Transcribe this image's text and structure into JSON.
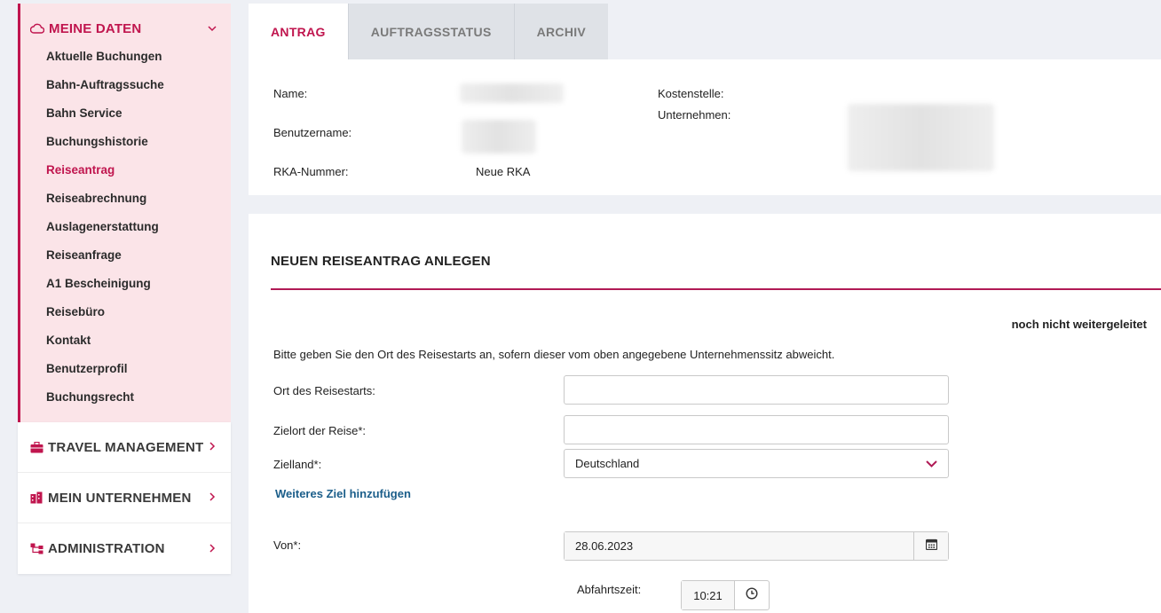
{
  "sidebar": {
    "open_group": {
      "title": "MEINE DATEN",
      "icon": "cloud-icon",
      "items": [
        {
          "label": "Aktuelle Buchungen",
          "active": false
        },
        {
          "label": "Bahn-Auftragssuche",
          "active": false
        },
        {
          "label": "Bahn Service",
          "active": false
        },
        {
          "label": "Buchungshistorie",
          "active": false
        },
        {
          "label": "Reiseantrag",
          "active": true
        },
        {
          "label": "Reiseabrechnung",
          "active": false
        },
        {
          "label": "Auslagenerstattung",
          "active": false
        },
        {
          "label": "Reiseanfrage",
          "active": false
        },
        {
          "label": "A1 Bescheinigung",
          "active": false
        },
        {
          "label": "Reisebüro",
          "active": false
        },
        {
          "label": "Kontakt",
          "active": false
        },
        {
          "label": "Benutzerprofil",
          "active": false
        },
        {
          "label": "Buchungsrecht",
          "active": false
        }
      ]
    },
    "groups": [
      {
        "title": "TRAVEL MANAGEMENT",
        "icon": "briefcase-icon"
      },
      {
        "title": "MEIN UNTERNEHMEN",
        "icon": "building-icon"
      },
      {
        "title": "ADMINISTRATION",
        "icon": "org-chart-icon"
      }
    ]
  },
  "tabs": [
    {
      "label": "ANTRAG",
      "active": true
    },
    {
      "label": "AUFTRAGSSTATUS",
      "active": false
    },
    {
      "label": "ARCHIV",
      "active": false
    }
  ],
  "info": {
    "name_label": "Name:",
    "username_label": "Benutzername:",
    "rka_label": "RKA-Nummer:",
    "rka_value": "Neue RKA",
    "cost_center_label": "Kostenstelle:",
    "company_label": "Unternehmen:"
  },
  "form": {
    "title": "NEUEN REISEANTRAG ANLEGEN",
    "status": "noch nicht weitergeleitet",
    "hint": "Bitte geben Sie den Ort des Reisestarts an, sofern dieser vom oben angegebene Unternehmenssitz abweicht.",
    "start_label": "Ort des Reisestarts:",
    "start_value": "",
    "destination_label": "Zielort der Reise*:",
    "destination_value": "",
    "country_label": "Zielland*:",
    "country_value": "Deutschland",
    "add_destination": "Weiteres Ziel hinzufügen",
    "from_label": "Von*:",
    "from_value": "28.06.2023",
    "departure_label": "Abfahrtszeit:",
    "departure_value": "10:21"
  },
  "colors": {
    "accent": "#c0154e",
    "link": "#1b5e8a",
    "sidebar_open_bg": "#fbe4e8",
    "page_bg": "#eef0f5"
  }
}
